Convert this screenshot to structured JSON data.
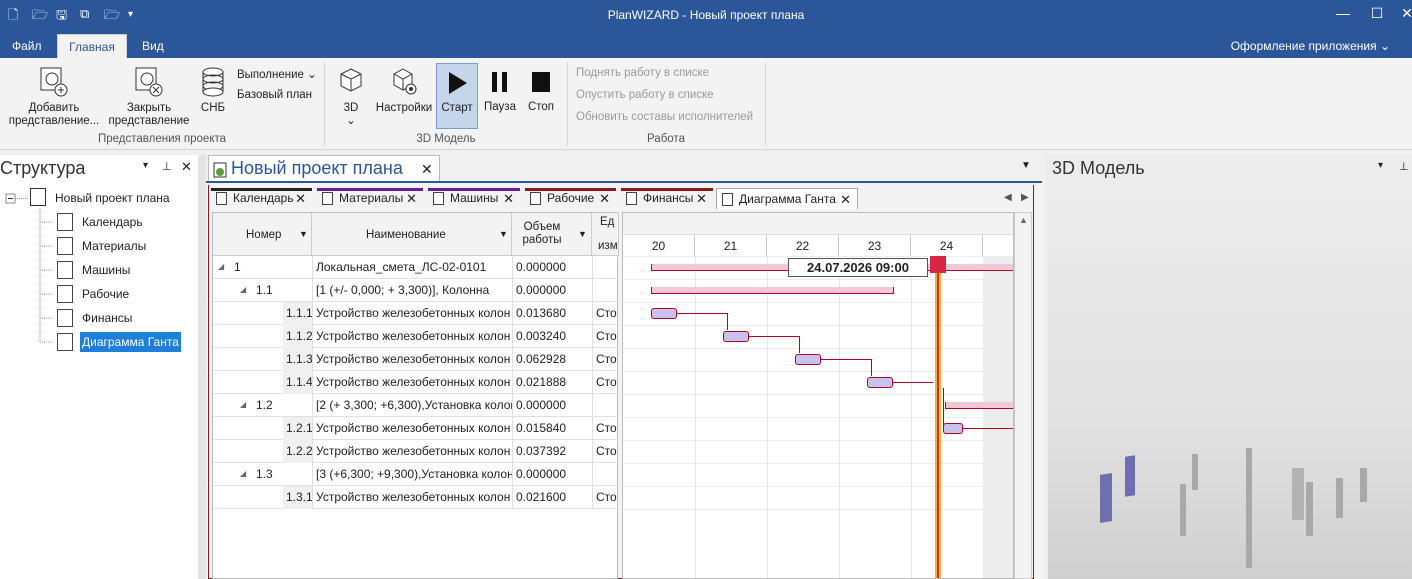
{
  "window": {
    "title": "PlanWIZARD - Новый проект плана",
    "min_icon": "minimize-icon",
    "max_icon": "maximize-icon",
    "close_icon": "close-icon"
  },
  "menu": {
    "tabs": [
      "Файл",
      "Главная",
      "Вид"
    ],
    "active": "Главная",
    "app_style": "Оформление приложения"
  },
  "ribbon": {
    "add_view": "Добавить представление...",
    "close_view": "Закрыть представление",
    "snb": "СНБ",
    "execution": "Выполнение",
    "base_plan": "Базовый план",
    "group_views": "Представления проекта",
    "btn_3d": "3D",
    "settings": "Настройки",
    "start": "Старт",
    "pause": "Пауза",
    "stop": "Стоп",
    "group_3d": "3D Модель",
    "move_up": "Поднять работу в списке",
    "move_down": "Опустить работу в списке",
    "update_staff": "Обновить составы исполнителей",
    "group_work": "Работа"
  },
  "left_panel": {
    "title": "Структура",
    "root": "Новый проект плана",
    "items": [
      "Календарь",
      "Материалы",
      "Машины",
      "Рабочие",
      "Финансы",
      "Диаграмма Ганта"
    ],
    "selected": "Диаграмма Ганта"
  },
  "document": {
    "tab_title": "Новый проект плана",
    "subtabs": [
      {
        "label": "Календарь",
        "color": "#222222"
      },
      {
        "label": "Материалы",
        "color": "#6a1b9a"
      },
      {
        "label": "Машины",
        "color": "#6a1b9a"
      },
      {
        "label": "Рабочие",
        "color": "#8b1a1a"
      },
      {
        "label": "Финансы",
        "color": "#8b1a1a"
      },
      {
        "label": "Диаграмма Ганта",
        "color": "#ffffff"
      }
    ],
    "active_subtab": "Диаграмма Ганта"
  },
  "grid": {
    "columns": [
      "Номер",
      "Наименование",
      "Объем работы",
      "Ед. изм"
    ],
    "col_unit_top": "Ед",
    "col_unit_bottom": "изм",
    "rows": [
      {
        "num": "1",
        "name": "Локальная_смета_ЛС-02-0101",
        "vol": "0.000000",
        "unit": "",
        "level": 0
      },
      {
        "num": "1.1",
        "name": "[1 (+/- 0,000; + 3,300)], Колонна",
        "vol": "0.000000",
        "unit": "",
        "level": 1
      },
      {
        "num": "1.1.1",
        "name": "Устройство железобетонных колон…",
        "vol": "0.013680",
        "unit": "Сто",
        "level": 2
      },
      {
        "num": "1.1.2",
        "name": "Устройство железобетонных колон…",
        "vol": "0.003240",
        "unit": "Сто",
        "level": 2
      },
      {
        "num": "1.1.3",
        "name": "Устройство железобетонных колон…",
        "vol": "0.062928",
        "unit": "Сто",
        "level": 2
      },
      {
        "num": "1.1.4",
        "name": "Устройство железобетонных колон…",
        "vol": "0.021888",
        "unit": "Сто",
        "level": 2
      },
      {
        "num": "1.2",
        "name": "[2 (+ 3,300; +6,300),Установка колон…",
        "vol": "0.000000",
        "unit": "",
        "level": 1
      },
      {
        "num": "1.2.1",
        "name": "Устройство железобетонных колон…",
        "vol": "0.015840",
        "unit": "Сто",
        "level": 2
      },
      {
        "num": "1.2.2",
        "name": "Устройство железобетонных колон…",
        "vol": "0.037392",
        "unit": "Сто",
        "level": 2
      },
      {
        "num": "1.3",
        "name": "[3 (+6,300; +9,300),Установка колон…",
        "vol": "0.000000",
        "unit": "",
        "level": 1
      },
      {
        "num": "1.3.1",
        "name": "Устройство железобетонных колон…",
        "vol": "0.021600",
        "unit": "Сто",
        "level": 2
      }
    ]
  },
  "gantt": {
    "days": [
      "20",
      "21",
      "22",
      "23",
      "24"
    ],
    "current_marker": "24.07.2026 09:00",
    "bar_color": "#c7c3ee",
    "line_color": "#b10020",
    "now_line_color": "#f5a623"
  },
  "right_panel": {
    "title": "3D Модель"
  }
}
